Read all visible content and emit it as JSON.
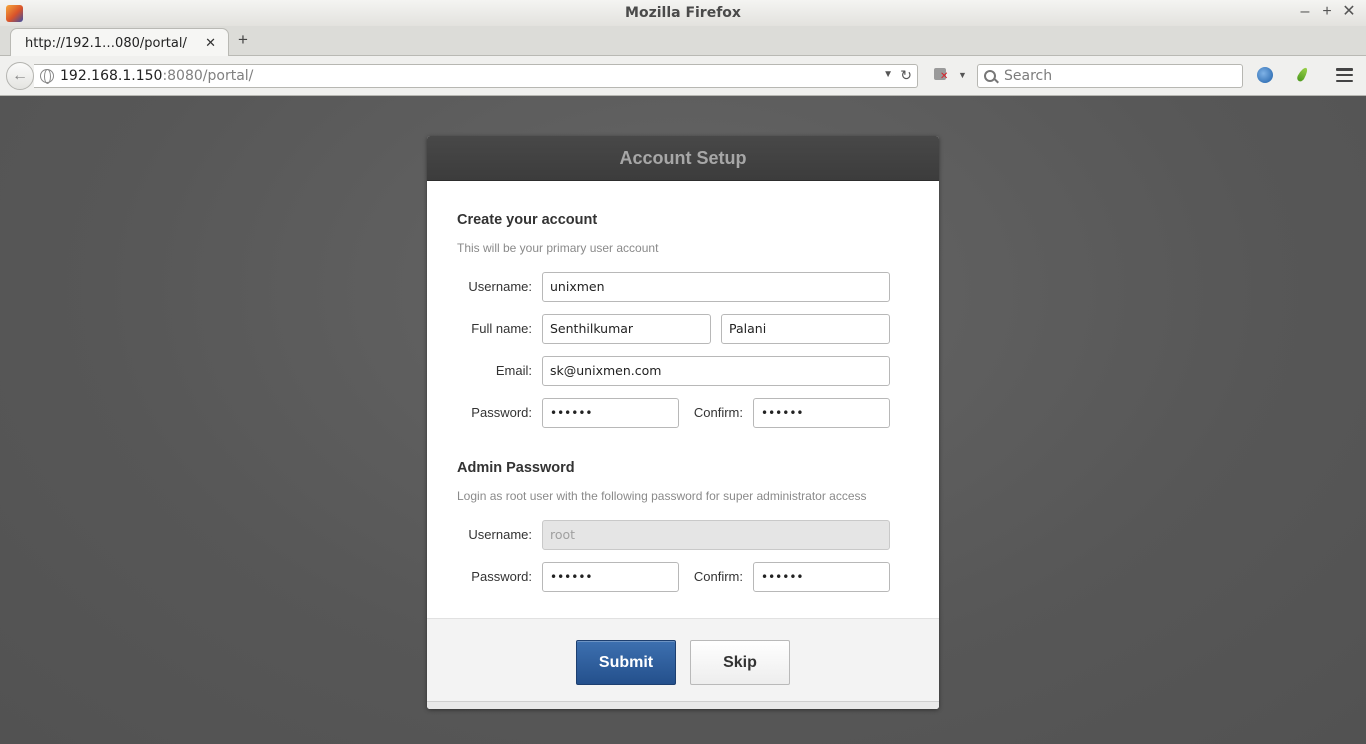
{
  "window": {
    "title": "Mozilla Firefox",
    "minimize": "–",
    "maximize": "+",
    "close": "✕"
  },
  "tabs": [
    {
      "label": "http://192.1…080/portal/",
      "close": "✕"
    }
  ],
  "new_tab": "+",
  "nav": {
    "back": "←",
    "url_host": "192.168.1.150",
    "url_rest": ":8080/portal/",
    "url_dropdown": "▼",
    "reload": "↻",
    "search_placeholder": "Search"
  },
  "page": {
    "card_title": "Account Setup",
    "account": {
      "title": "Create your account",
      "desc": "This will be your primary user account",
      "username_label": "Username:",
      "username": "unixmen",
      "fullname_label": "Full name:",
      "first_name": "Senthilkumar",
      "last_name": "Palani",
      "email_label": "Email:",
      "email": "sk@unixmen.com",
      "password_label": "Password:",
      "password": "••••••",
      "confirm_label": "Confirm:",
      "confirm": "••••••"
    },
    "admin": {
      "title": "Admin Password",
      "desc": "Login as root user with the following password for super administrator access",
      "username_label": "Username:",
      "username": "root",
      "password_label": "Password:",
      "password": "••••••",
      "confirm_label": "Confirm:",
      "confirm": "••••••"
    },
    "buttons": {
      "submit": "Submit",
      "skip": "Skip"
    }
  },
  "colors": {
    "accent": "#2d5f9e",
    "background": "#575757",
    "header": "#414141"
  }
}
